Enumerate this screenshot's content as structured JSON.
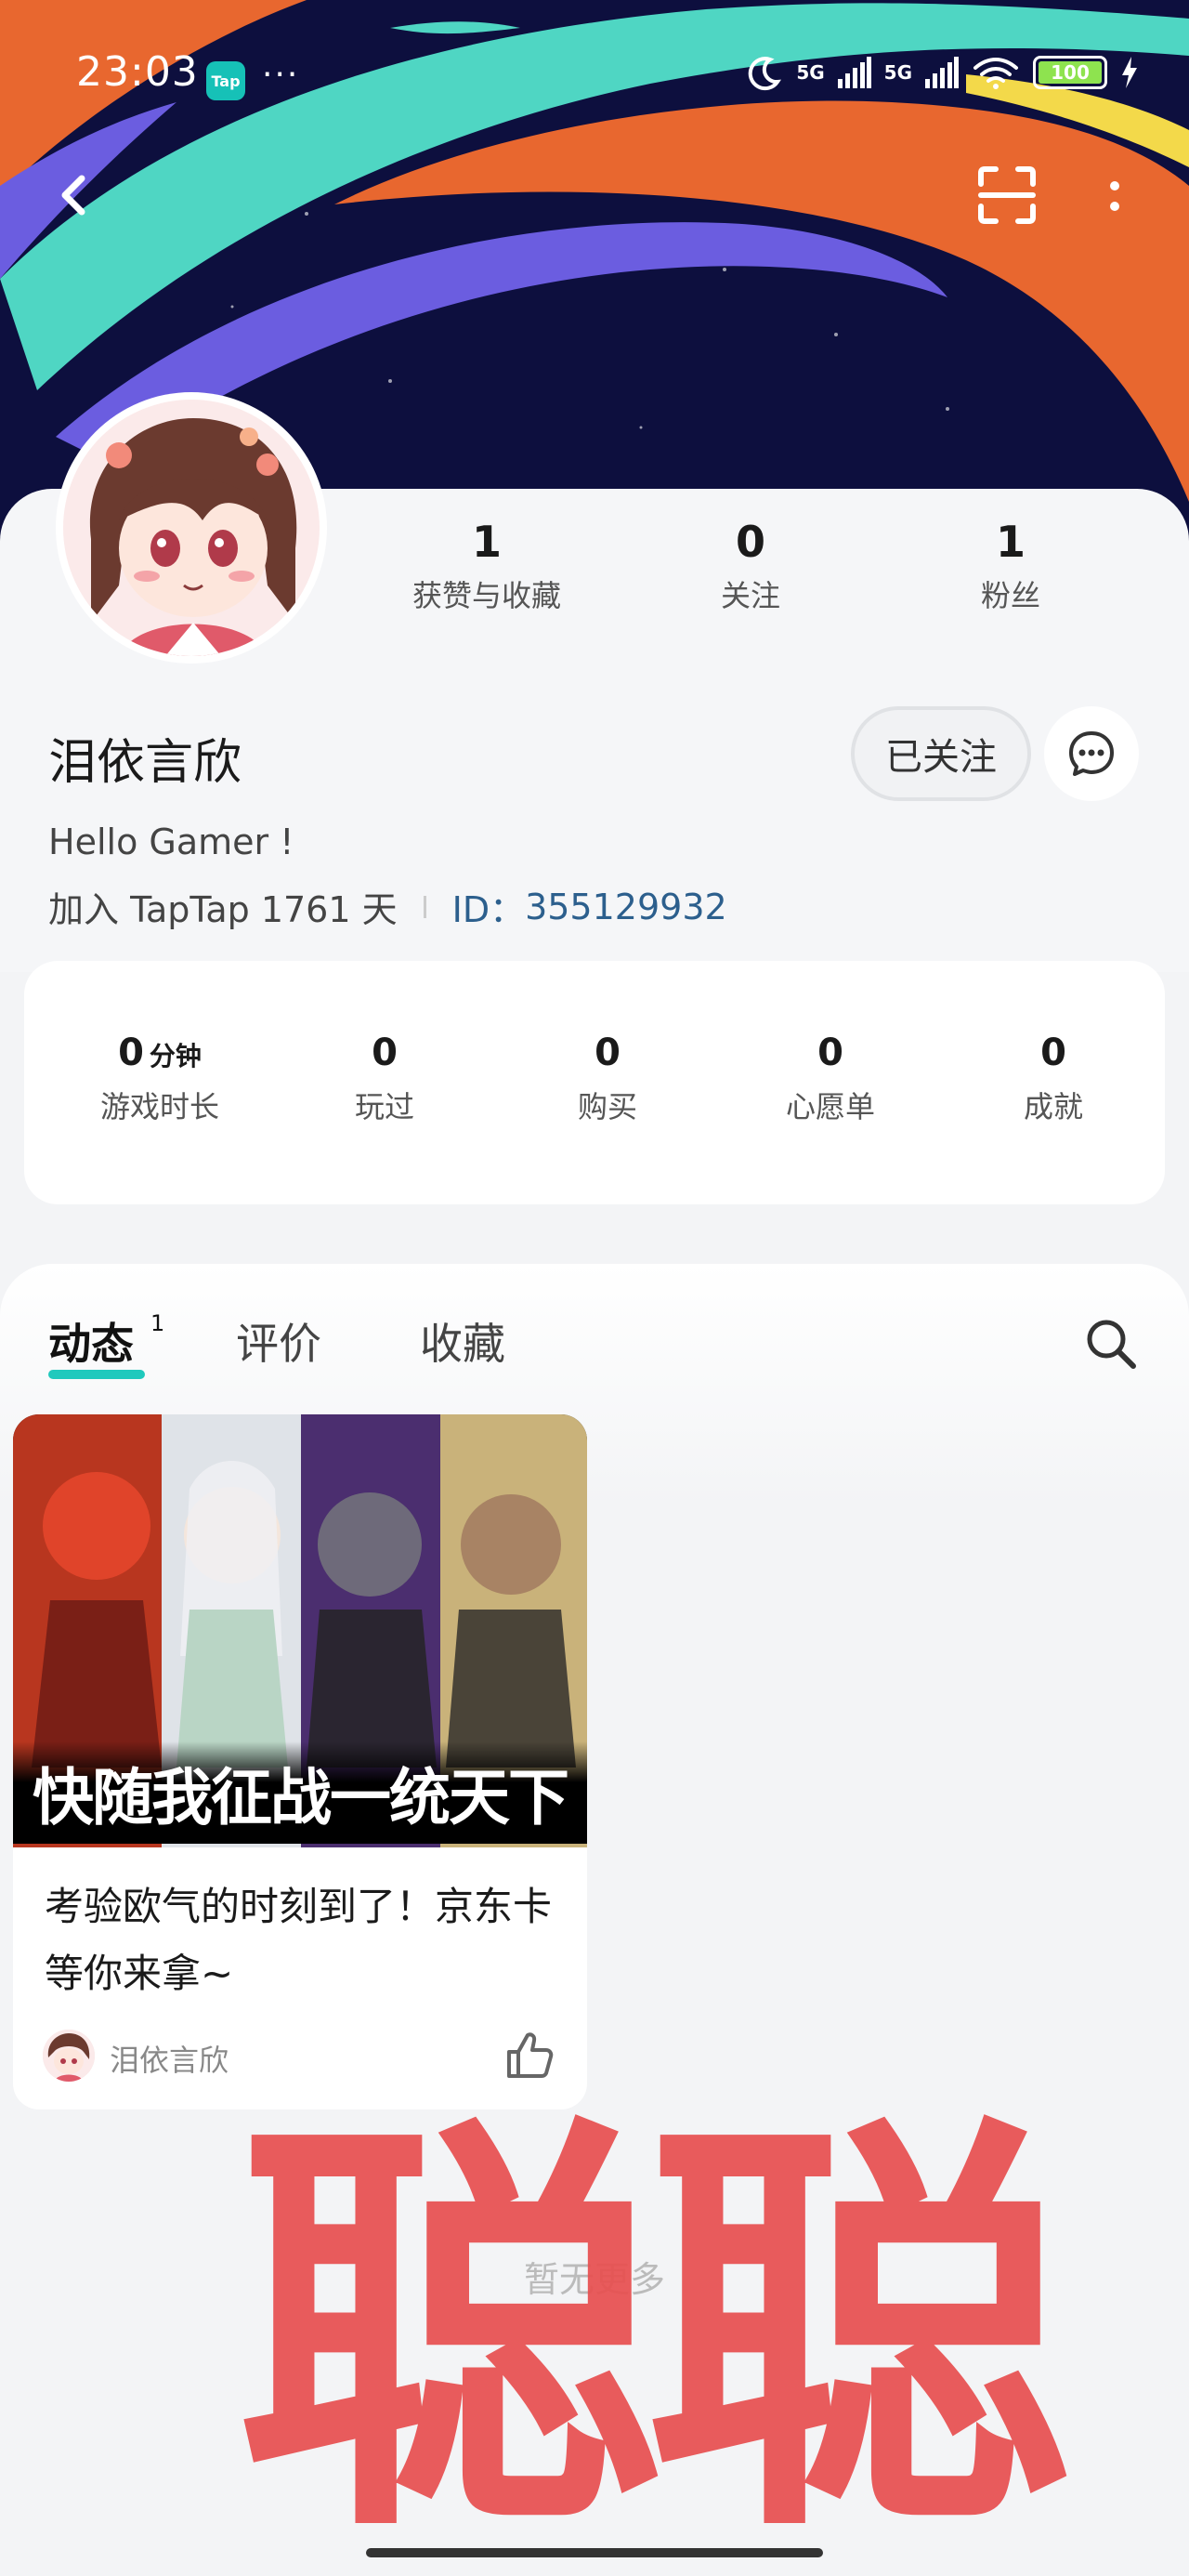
{
  "status_bar": {
    "time": "23:03",
    "app_icon_label": "Tap",
    "network_1": "5G",
    "network_2": "5G",
    "battery": "100"
  },
  "profile": {
    "username": "泪依言欣",
    "bio": "Hello Gamer !",
    "joined": "加入 TapTap 1761 天",
    "id_label": "ID：",
    "id_value": "355129932",
    "follow_button": "已关注",
    "stats": [
      {
        "value": "1",
        "label": "获赞与收藏"
      },
      {
        "value": "0",
        "label": "关注"
      },
      {
        "value": "1",
        "label": "粉丝"
      }
    ]
  },
  "game_stats": [
    {
      "value": "0",
      "unit": "分钟",
      "label": "游戏时长"
    },
    {
      "value": "0",
      "unit": "",
      "label": "玩过"
    },
    {
      "value": "0",
      "unit": "",
      "label": "购买"
    },
    {
      "value": "0",
      "unit": "",
      "label": "心愿单"
    },
    {
      "value": "0",
      "unit": "",
      "label": "成就"
    }
  ],
  "tabs": [
    {
      "label": "动态",
      "badge": "1",
      "active": true
    },
    {
      "label": "评价",
      "badge": "",
      "active": false
    },
    {
      "label": "收藏",
      "badge": "",
      "active": false
    }
  ],
  "post": {
    "image_caption": "快随我征战一统天下",
    "title": "考验欧气的时刻到了！京东卡等你来拿~",
    "author": "泪依言欣"
  },
  "footer": {
    "no_more": "暂无更多"
  },
  "watermark": "聪聪",
  "colors": {
    "accent": "#20c9bd",
    "id_link": "#2c5f8d",
    "watermark": "#e84f4f",
    "banner_bg": "#0d0f3e"
  }
}
